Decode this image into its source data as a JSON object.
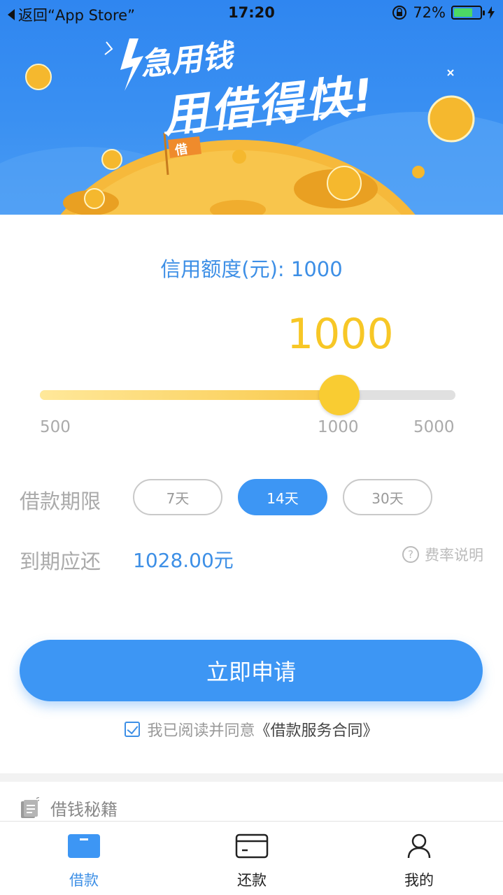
{
  "status_bar": {
    "back_label": "返回“App Store”",
    "time": "17:20",
    "battery_percent_text": "72%",
    "battery_level": 0.72
  },
  "banner": {
    "slogan_line1": "急用钱",
    "slogan_line2": "用借得快!",
    "flag_text": "借"
  },
  "loan": {
    "credit_limit_label": "信用额度(元): 1000",
    "selected_amount": "1000",
    "slider": {
      "min_label": "500",
      "current_label": "1000",
      "max_label": "5000",
      "position": 0.72
    },
    "term_label": "借款期限",
    "terms": [
      {
        "label": "7天",
        "active": false
      },
      {
        "label": "14天",
        "active": true
      },
      {
        "label": "30天",
        "active": false
      }
    ],
    "due_label": "到期应还",
    "due_value": "1028.00元",
    "rate_link": "费率说明",
    "apply_button": "立即申请",
    "agreement_text": "我已阅读并同意",
    "agreement_link": "《借款服务合同》"
  },
  "tips": {
    "label": "借钱秘籍"
  },
  "tab_bar": {
    "items": [
      {
        "label": "借款",
        "icon": "card-icon",
        "active": true
      },
      {
        "label": "还款",
        "icon": "repay-card-icon",
        "active": false
      },
      {
        "label": "我的",
        "icon": "person-icon",
        "active": false
      }
    ]
  },
  "colors": {
    "primary": "#3d96f4",
    "accent": "#f7c726",
    "banner": "#2f86f0"
  }
}
